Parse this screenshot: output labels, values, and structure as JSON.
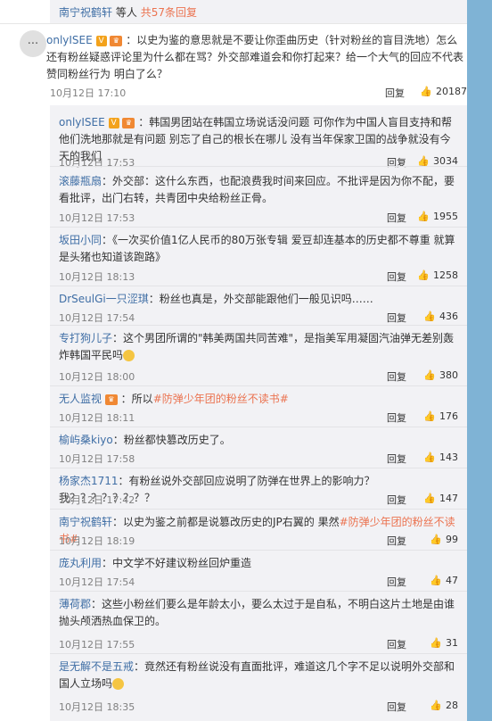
{
  "top_reply": {
    "user": "南宁祝鹤轩",
    "mid": "等人",
    "count": "共57条回复"
  },
  "main": {
    "avatar_glyph": "...",
    "user": "onlyISEE",
    "text": "：以史为鉴的意思就是不要让你歪曲历史（针对粉丝的盲目洗地）怎么还有粉丝疑惑评论里为什么都在骂？外交部难道会和你打起来？给一个大气的回应不代表赞同粉丝行为 明白了么？",
    "time": "10月12日 17:10",
    "reply_label": "回复",
    "likes": "20187"
  },
  "replies": [
    {
      "user": "onlyISEE",
      "text": "：韩国男团站在韩国立场说话没问题 可你作为中国人盲目支持和帮他们洗地那就是有问题 别忘了自己的根长在哪儿 没有当年保家卫国的战争就没有今天的我们",
      "time": "10月12日 17:53",
      "reply": "回复",
      "likes": "3034"
    },
    {
      "user": "滚藤瓶扇",
      "text": "：外交部：这什么东西，也配浪费我时间来回应。不批评是因为你不配，要看批评，出门右转，共青团中央给粉丝正骨。",
      "time": "10月12日 17:53",
      "reply": "回复",
      "likes": "1955"
    },
    {
      "user": "坂田小同",
      "text": "：《一次买价值1亿人民币的80万张专辑 爱豆却连基本的历史都不尊重 就算是头猪也知道该跑路》",
      "time": "10月12日 18:13",
      "reply": "回复",
      "likes": "1258"
    },
    {
      "user": "DrSeulGi一只涩琪",
      "text": "：粉丝也真是，外交部能跟他们一般见识吗……",
      "time": "10月12日 17:54",
      "reply": "回复",
      "likes": "436"
    },
    {
      "user": "专打狗儿子",
      "text": "：这个男团所谓的\"韩美两国共同苦难\"，是指美军用凝固汽油弹无差别轰炸韩国平民吗",
      "time": "10月12日 18:00",
      "reply": "回复",
      "likes": "380"
    },
    {
      "user": "无人监视",
      "text": "：所以",
      "tag": "#防弹少年团的粉丝不读书#",
      "time": "10月12日 18:11",
      "reply": "回复",
      "likes": "176"
    },
    {
      "user": "榆屿桑kiyo",
      "text": "：粉丝都快篡改历史了。",
      "time": "10月12日 17:58",
      "reply": "回复",
      "likes": "143"
    },
    {
      "user": "杨家杰1711",
      "text": "：有粉丝说外交部回应说明了防弹在世界上的影响力？我？？？？？？？？",
      "time": "10月12日 17:42",
      "reply": "回复",
      "likes": "147"
    },
    {
      "user": "南宁祝鹤轩",
      "text": "：以史为鉴之前都是说篡改历史的JP右翼的 果然",
      "tag": "#防弹少年团的粉丝不读书#",
      "time": "10月12日 18:19",
      "reply": "回复",
      "likes": "99"
    },
    {
      "user": "庞丸利用",
      "text": "：中文学不好建议粉丝回炉重造",
      "time": "10月12日 17:54",
      "reply": "回复",
      "likes": "47"
    },
    {
      "user": "薄荷郡",
      "text": "：这些小粉丝们要么是年龄太小，要么太过于是自私，不明白这片土地是由谁抛头颅洒热血保卫的。",
      "time": "10月12日 17:55",
      "reply": "回复",
      "likes": "31"
    },
    {
      "user": "是无解不是五戒",
      "text": "：竟然还有粉丝说没有直面批评，难道这几个字不足以说明外交部和国人立场吗",
      "time": "10月12日 18:35",
      "reply": "回复",
      "likes": "28"
    }
  ],
  "icons": {
    "like": "thumbs-up-icon",
    "vip": "vip-badge-icon",
    "verified": "verified-v-icon"
  },
  "colors": {
    "link": "#eb7350",
    "name": "#3f6ea5",
    "panel": "#f2f2f5"
  }
}
